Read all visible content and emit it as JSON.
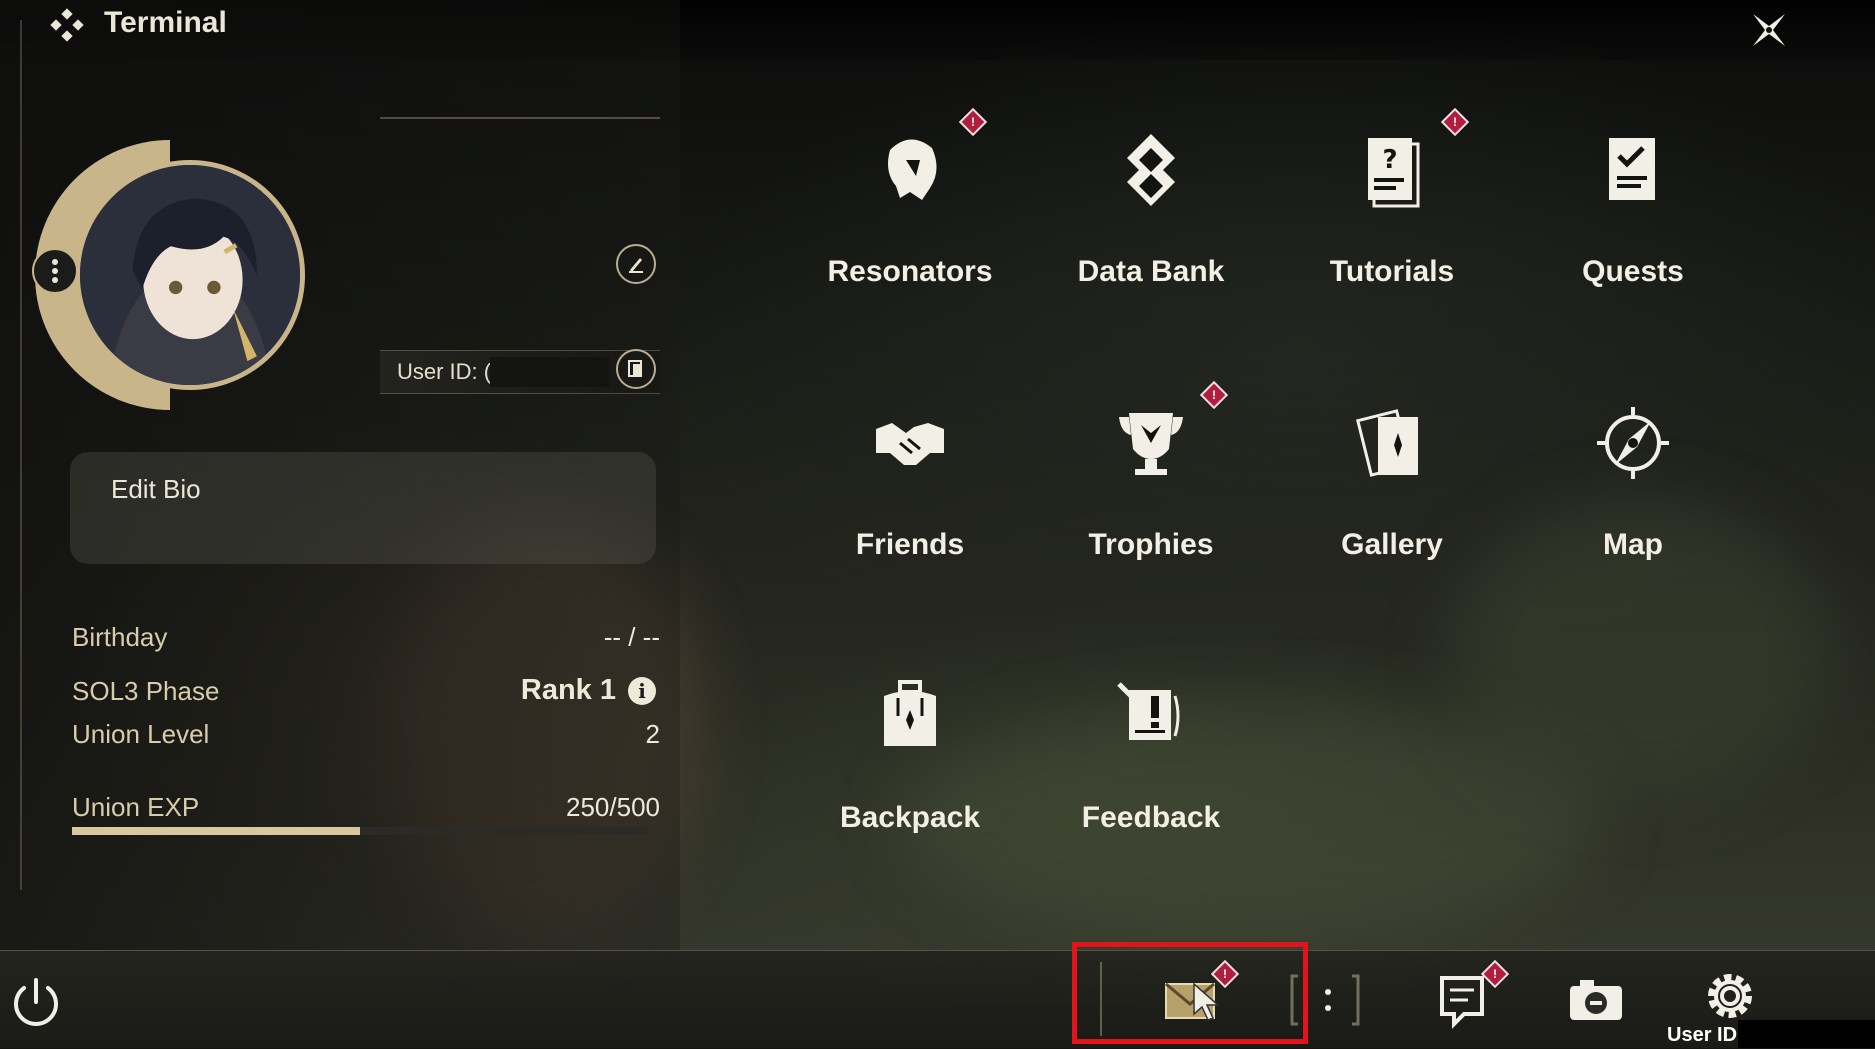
{
  "header": {
    "title": "Terminal"
  },
  "profile": {
    "user_id_label": "User ID: (",
    "bio_placeholder": "Edit Bio",
    "stats": {
      "birthday_label": "Birthday",
      "birthday_value": "-- / --",
      "sol3_label": "SOL3 Phase",
      "sol3_value": "Rank 1",
      "union_level_label": "Union Level",
      "union_level_value": "2",
      "union_exp_label": "Union EXP",
      "union_exp_value": "250/500",
      "union_exp_fraction": 0.5
    }
  },
  "menu": {
    "items": [
      {
        "label": "Resonators",
        "icon": "resonators-icon",
        "badge": true
      },
      {
        "label": "Data Bank",
        "icon": "data-bank-icon",
        "badge": false
      },
      {
        "label": "Tutorials",
        "icon": "tutorials-icon",
        "badge": true
      },
      {
        "label": "Quests",
        "icon": "quests-icon",
        "badge": false
      },
      {
        "label": "Friends",
        "icon": "friends-icon",
        "badge": false
      },
      {
        "label": "Trophies",
        "icon": "trophies-icon",
        "badge": true
      },
      {
        "label": "Gallery",
        "icon": "gallery-icon",
        "badge": false
      },
      {
        "label": "Map",
        "icon": "map-icon",
        "badge": false
      },
      {
        "label": "Backpack",
        "icon": "backpack-icon",
        "badge": false
      },
      {
        "label": "Feedback",
        "icon": "feedback-icon",
        "badge": false
      }
    ]
  },
  "bottom_bar": {
    "user_id_label": "User ID:",
    "icons": [
      "power-icon",
      "mail-icon",
      "cursor-icon",
      "bracket-icon",
      "announcement-icon",
      "camera-icon",
      "settings-icon"
    ]
  },
  "badge_glyph": "!",
  "info_glyph": "i",
  "colors": {
    "accent": "#c9b58a",
    "badge": "#b11d3d",
    "highlight": "#e2141b"
  }
}
